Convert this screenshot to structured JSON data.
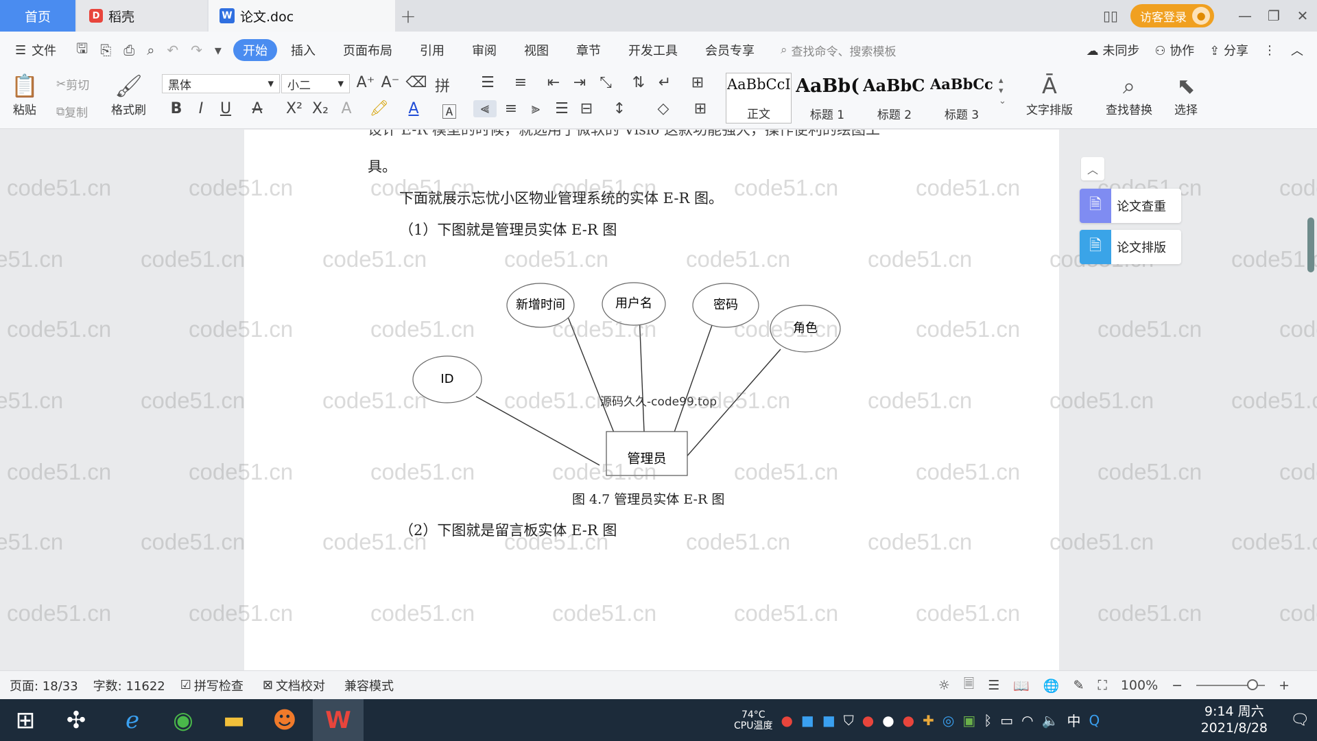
{
  "tabs": {
    "home": "首页",
    "daoke": "稻壳",
    "doc": "论文.doc",
    "add": "+"
  },
  "window": {
    "login": "访客登录"
  },
  "menu": {
    "file": "文件",
    "items": [
      "开始",
      "插入",
      "页面布局",
      "引用",
      "审阅",
      "视图",
      "章节",
      "开发工具",
      "会员专享"
    ],
    "search_placeholder": "查找命令、搜索模板",
    "sync": "未同步",
    "collab": "协作",
    "share": "分享"
  },
  "ribbon": {
    "paste": "粘贴",
    "cut": "剪切",
    "copy": "复制",
    "format_painter": "格式刷",
    "font_name": "黑体",
    "font_size": "小二",
    "styles": [
      {
        "sample": "AaBbCcI",
        "label": "正文"
      },
      {
        "sample": "AaBb(",
        "label": "标题 1"
      },
      {
        "sample": "AaBbC",
        "label": "标题 2"
      },
      {
        "sample": "AaBbCcl",
        "label": "标题 3"
      }
    ],
    "text_layout": "文字排版",
    "find_replace": "查找替换",
    "select": "选择"
  },
  "document": {
    "line_partial": "设计 E-R 模型的时候，就选用了微软的 Visio 这款功能强大，操作便利的绘图工",
    "line_end": "具。",
    "intro": "下面就展示忘忧小区物业管理系统的实体 E-R 图。",
    "heading1": "（1）下图就是管理员实体 E-R 图",
    "caption": "图 4.7  管理员实体 E-R 图",
    "heading2": "（2）下图就是留言板实体 E-R 图",
    "diagram_watermark": "源码久久-code99.top",
    "watermark": "code51.cn"
  },
  "diagram": {
    "entity": "管理员",
    "attributes": [
      "ID",
      "新增时间",
      "用户名",
      "密码",
      "角色"
    ]
  },
  "side_panel": {
    "check": "论文查重",
    "layout": "论文排版"
  },
  "status": {
    "page": "页面: 18/33",
    "words": "字数: 11622",
    "spell": "拼写检查",
    "proof": "文档校对",
    "compat": "兼容模式",
    "zoom": "100%",
    "zoom_level": 0.82
  },
  "taskbar": {
    "temp": "74°C",
    "temp_label": "CPU温度",
    "ime": "中",
    "time": "9:14 周六",
    "date": "2021/8/28"
  }
}
